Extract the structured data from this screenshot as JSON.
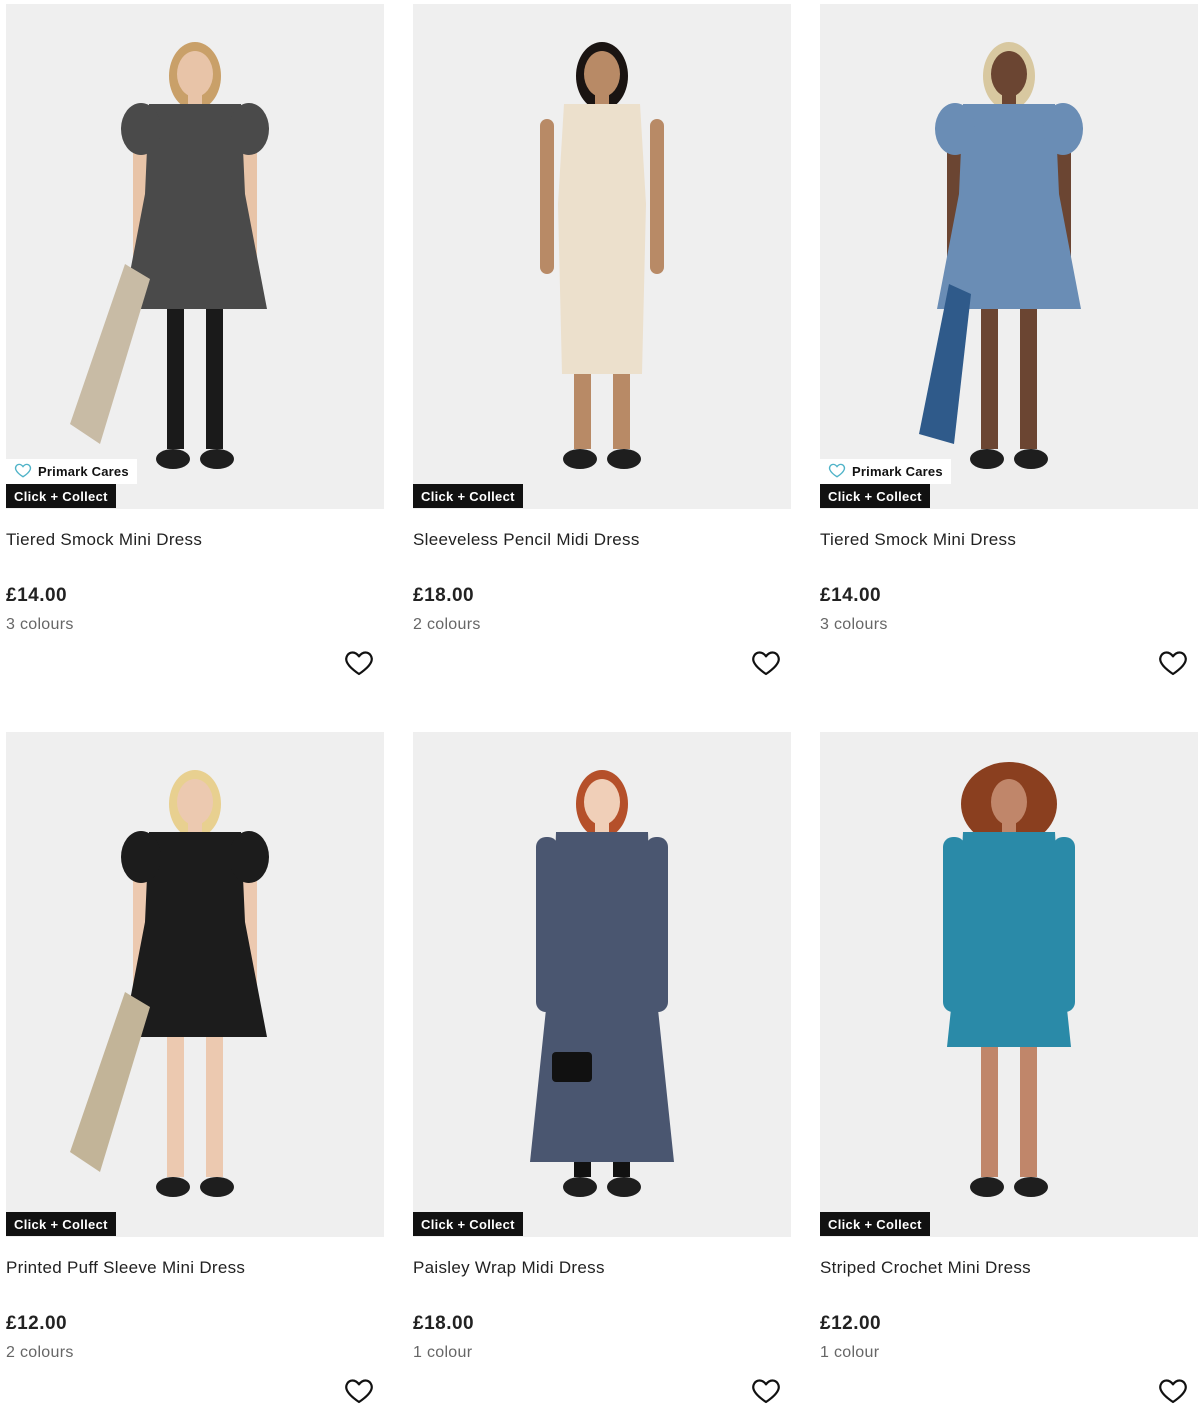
{
  "products": [
    {
      "title": "Tiered Smock Mini Dress",
      "price": "£14.00",
      "colours": "3 colours",
      "primark_cares": true,
      "cares_label": "Primark Cares",
      "collect_label": "Click + Collect",
      "dress_color": "#4a4a4a",
      "skin_color": "#e8c4a8",
      "hair_color": "#c9a069",
      "accessory_color": "#c8bba5",
      "leg_color": "#1a1a1a"
    },
    {
      "title": "Sleeveless Pencil Midi Dress",
      "price": "£18.00",
      "colours": "2 colours",
      "primark_cares": false,
      "collect_label": "Click + Collect",
      "dress_color": "#ece0cc",
      "skin_color": "#b88a66",
      "hair_color": "#1a1412",
      "accessory_color": "#ece0cc",
      "leg_color": "#b88a66"
    },
    {
      "title": "Tiered Smock Mini Dress",
      "price": "£14.00",
      "colours": "3 colours",
      "primark_cares": true,
      "cares_label": "Primark Cares",
      "collect_label": "Click + Collect",
      "dress_color": "#6a8db5",
      "skin_color": "#6b4532",
      "hair_color": "#d8c8a0",
      "accessory_color": "#2f5a8a",
      "leg_color": "#6b4532"
    },
    {
      "title": "Printed Puff Sleeve Mini Dress",
      "price": "£12.00",
      "colours": "2 colours",
      "primark_cares": false,
      "collect_label": "Click + Collect",
      "dress_color": "#1c1c1c",
      "skin_color": "#ecc9b0",
      "hair_color": "#e8d090",
      "accessory_color": "#c2b498",
      "leg_color": "#ecc9b0"
    },
    {
      "title": "Paisley Wrap Midi Dress",
      "price": "£18.00",
      "colours": "1 colour",
      "primark_cares": false,
      "collect_label": "Click + Collect",
      "dress_color": "#4a5670",
      "skin_color": "#f0cfb8",
      "hair_color": "#b5502a",
      "accessory_color": "#111111",
      "leg_color": "#111111"
    },
    {
      "title": "Striped Crochet Mini Dress",
      "price": "£12.00",
      "colours": "1 colour",
      "primark_cares": false,
      "collect_label": "Click + Collect",
      "dress_color": "#2a8aa8",
      "skin_color": "#c0866a",
      "hair_color": "#8a3f1f",
      "accessory_color": "#d8c8a8",
      "leg_color": "#c0866a"
    }
  ]
}
